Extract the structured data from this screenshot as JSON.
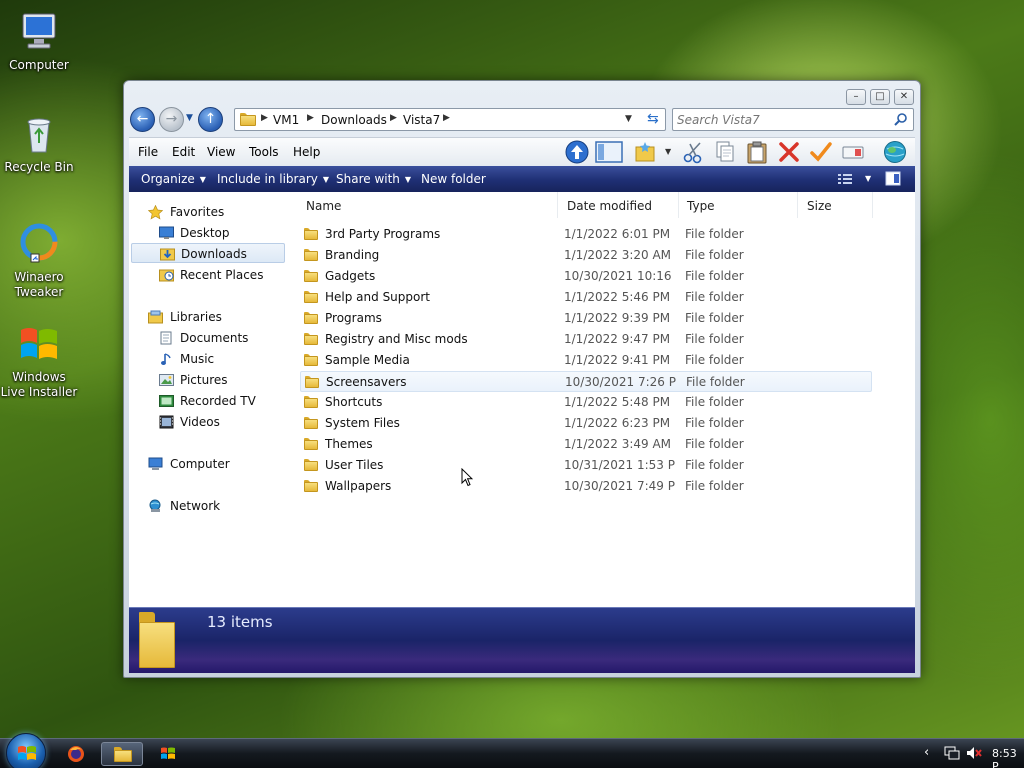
{
  "desktop": {
    "icons": [
      {
        "label": "Computer"
      },
      {
        "label": "Recycle Bin"
      },
      {
        "label": "Winaero Tweaker"
      },
      {
        "label": "Windows Live Installer"
      }
    ]
  },
  "window": {
    "controls": {
      "minimize": "–",
      "maximize": "□",
      "close": "✕"
    },
    "address": {
      "crumbs": [
        "VM1",
        "Downloads",
        "Vista7"
      ]
    },
    "search": {
      "placeholder": "Search Vista7"
    },
    "menu": [
      "File",
      "Edit",
      "View",
      "Tools",
      "Help"
    ],
    "commands": [
      {
        "label": "Organize"
      },
      {
        "label": "Include in library"
      },
      {
        "label": "Share with"
      },
      {
        "label": "New folder"
      }
    ],
    "nav": {
      "favorites": {
        "label": "Favorites",
        "items": [
          "Desktop",
          "Downloads",
          "Recent Places"
        ]
      },
      "libraries": {
        "label": "Libraries",
        "items": [
          "Documents",
          "Music",
          "Pictures",
          "Recorded TV",
          "Videos"
        ]
      },
      "computer": "Computer",
      "network": "Network"
    },
    "columns": {
      "name": "Name",
      "date": "Date modified",
      "type": "Type",
      "size": "Size"
    },
    "files": [
      {
        "name": "3rd Party Programs",
        "date": "1/1/2022 6:01 PM",
        "type": "File folder"
      },
      {
        "name": "Branding",
        "date": "1/1/2022 3:20 AM",
        "type": "File folder"
      },
      {
        "name": "Gadgets",
        "date": "10/30/2021 10:16 ...",
        "type": "File folder"
      },
      {
        "name": "Help and Support",
        "date": "1/1/2022 5:46 PM",
        "type": "File folder"
      },
      {
        "name": "Programs",
        "date": "1/1/2022 9:39 PM",
        "type": "File folder"
      },
      {
        "name": "Registry and Misc mods",
        "date": "1/1/2022 9:47 PM",
        "type": "File folder"
      },
      {
        "name": "Sample Media",
        "date": "1/1/2022 9:41 PM",
        "type": "File folder"
      },
      {
        "name": "Screensavers",
        "date": "10/30/2021 7:26 PM",
        "type": "File folder"
      },
      {
        "name": "Shortcuts",
        "date": "1/1/2022 5:48 PM",
        "type": "File folder"
      },
      {
        "name": "System Files",
        "date": "1/1/2022 6:23 PM",
        "type": "File folder"
      },
      {
        "name": "Themes",
        "date": "1/1/2022 3:49 AM",
        "type": "File folder"
      },
      {
        "name": "User Tiles",
        "date": "10/31/2021 1:53 PM",
        "type": "File folder"
      },
      {
        "name": "Wallpapers",
        "date": "10/30/2021 7:49 PM",
        "type": "File folder"
      }
    ],
    "details": {
      "count": "13 items"
    }
  },
  "taskbar": {
    "clock": "8:53 P"
  },
  "colors": {
    "accent": "#1f2f74",
    "selection": "#dde9f6"
  }
}
